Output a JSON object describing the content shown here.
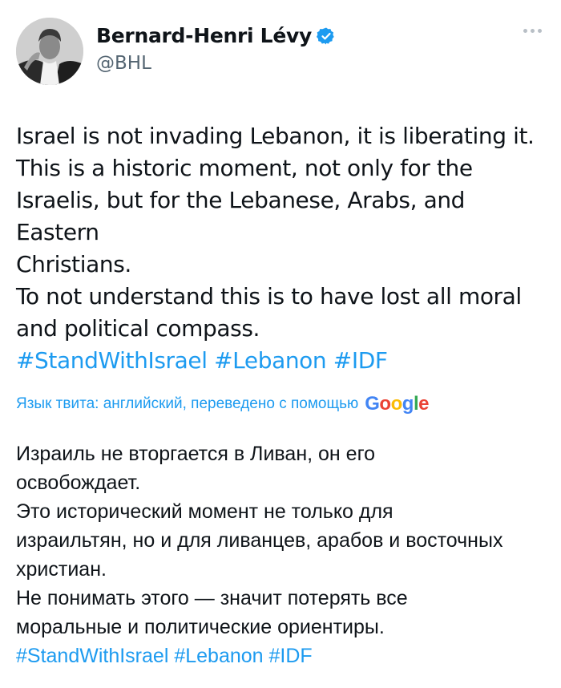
{
  "author": {
    "name": "Bernard-Henri Lévy",
    "handle": "@BHL"
  },
  "icons": {
    "avatar": "profile-photo",
    "verified": "verified-badge-icon",
    "more": "more-options-icon"
  },
  "tweet": {
    "lines": [
      "Israel is not invading Lebanon, it is liberating it.",
      "This is a historic moment, not only for the",
      "Israelis, but for the Lebanese, Arabs, and Eastern",
      "Christians.",
      "To not understand this is to have lost all moral",
      "and political compass."
    ],
    "hashtags": [
      "#StandWithIsrael",
      "#Lebanon",
      "#IDF"
    ]
  },
  "translation_notice": {
    "text": "Язык твита: английский, переведено с помощью",
    "provider_letters": [
      "G",
      "o",
      "o",
      "g",
      "l",
      "e"
    ]
  },
  "translation": {
    "lines": [
      "Израиль не вторгается в Ливан, он его",
      "освобождает.",
      "Это исторический момент не только для",
      "израильтян, но и для ливанцев, арабов и восточных",
      "христиан.",
      "Не понимать этого — значит потерять все",
      "моральные и политические ориентиры."
    ],
    "hashtags": [
      "#StandWithIsrael",
      "#Lebanon",
      "#IDF"
    ]
  },
  "colors": {
    "link": "#1d9bf0",
    "verified": "#1d9bf0",
    "text": "#0f1419",
    "secondary": "#536471"
  }
}
